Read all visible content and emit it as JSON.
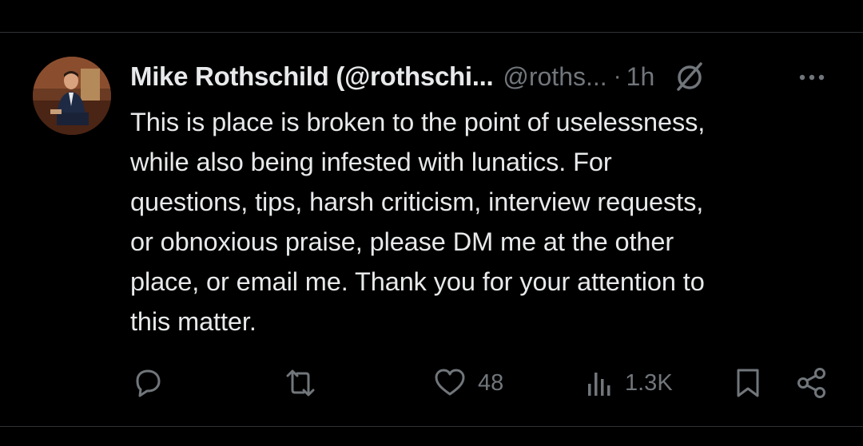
{
  "tweet": {
    "author": {
      "display_name": "Mike Rothschild (@rothschi...",
      "handle": "@roths...",
      "separator": "·",
      "time": "1h"
    },
    "text": "This is place is broken to the point of uselessness,\nwhile also being infested with lunatics. For\nquestions, tips, harsh criticism, interview requests,\nor obnoxious praise, please DM me at the other\nplace, or email me. Thank you for your attention to\nthis matter.",
    "actions": {
      "reply_icon": "reply-icon",
      "retweet_icon": "retweet-icon",
      "like_icon": "heart-icon",
      "like_count": "48",
      "views_icon": "views-icon",
      "views_count": "1.3K",
      "bookmark_icon": "bookmark-icon",
      "share_icon": "share-icon"
    }
  },
  "colors": {
    "background": "#000000",
    "primary_text": "#e7e9ea",
    "secondary_text": "#71767b",
    "divider": "#2f3336"
  }
}
